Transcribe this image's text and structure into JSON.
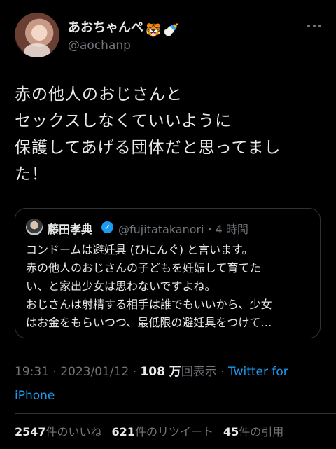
{
  "author": {
    "display_name": "あおちゃんぺ",
    "emoji_1": "🐯",
    "emoji_2": "🍼",
    "handle": "@aochanp"
  },
  "tweet": {
    "lines": [
      "赤の他人のおじさんと",
      "セックスしなくていいように",
      "保護してあげる団体だと思ってまし",
      "た！"
    ]
  },
  "quote": {
    "name": "藤田孝典",
    "verified_mark": "✓",
    "handle_time": "@fujitatakanori・4 時間",
    "lines": [
      "コンドームは避妊具 (ひにんぐ) と言います。",
      "赤の他人のおじさんの子どもを妊娠して育てた",
      "い、と家出少女は思わないですよね。",
      "おじさんは射精する相手は誰でもいいから、少女",
      "はお金をもらいつつ、最低限の避妊具をつけて…"
    ]
  },
  "meta": {
    "timestamp": "19:31 · 2023/01/12 · ",
    "views_count": "108 万",
    "views_label": "回表示 · ",
    "source": "Twitter for iPhone"
  },
  "stats": {
    "likes_count": "2547",
    "likes_label": "件のいいね",
    "retweets_count": "621",
    "retweets_label": "件のリツイート",
    "quotes_count": "45",
    "quotes_label": "件の引用"
  },
  "colors": {
    "background": "#000000",
    "text": "#e7e9ea",
    "muted": "#71767b",
    "accent": "#1d9bf0",
    "border": "#2f3336"
  }
}
